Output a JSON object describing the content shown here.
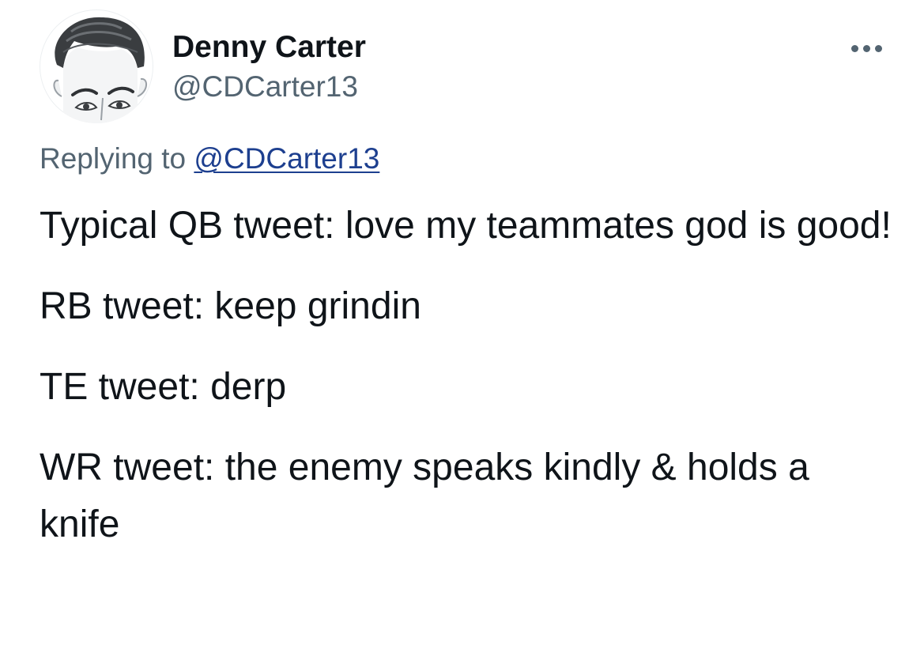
{
  "author": {
    "display_name": "Denny Carter",
    "handle": "@CDCarter13",
    "avatar_icon": "cartoon-portrait-avatar"
  },
  "more_menu": {
    "icon": "more-horizontal-icon"
  },
  "reply_context": {
    "prefix": "Replying to",
    "mention": "@CDCarter13"
  },
  "body": {
    "paragraphs": [
      "Typical QB tweet: love my teammates god is good!",
      "RB tweet: keep grindin",
      "TE tweet: derp",
      "WR tweet: the enemy speaks kindly & holds a knife"
    ]
  },
  "colors": {
    "text_primary": "#0f1419",
    "text_secondary": "#536471",
    "mention_link": "#1d3f8f",
    "background": "#ffffff"
  }
}
